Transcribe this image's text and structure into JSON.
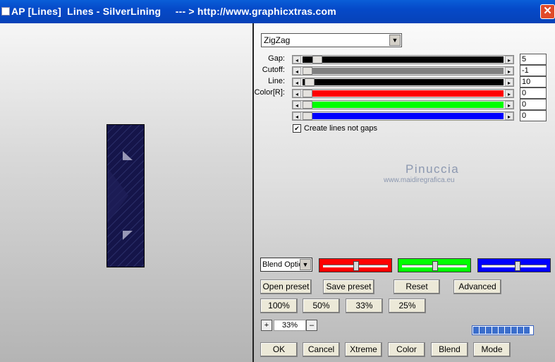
{
  "window": {
    "title": "AP [Lines]  Lines - SilverLining     --- > http://www.graphicxtras.com",
    "close_glyph": "✕"
  },
  "mode": {
    "value": "ZigZag",
    "arrow": "▼"
  },
  "sliders": [
    {
      "label": "Gap:",
      "value": "5",
      "fraction": 0.05,
      "color": "#000000"
    },
    {
      "label": "Cutoff:",
      "value": "-1",
      "fraction": 0.0,
      "color": "#808080"
    },
    {
      "label": "Line:",
      "value": "10",
      "fraction": 0.01,
      "color": "#000000"
    },
    {
      "label": "Color[R]:",
      "value": "0",
      "fraction": 0.0,
      "color": "#ff0000"
    },
    {
      "label": "",
      "value": "0",
      "fraction": 0.0,
      "color": "#00ff00"
    },
    {
      "label": "",
      "value": "0",
      "fraction": 0.0,
      "color": "#0000ff"
    }
  ],
  "checkbox": {
    "label": "Create lines not gaps",
    "checked": true,
    "mark": "✔"
  },
  "watermark": {
    "name": "Pinuccia",
    "url": "www.maidiregrafica.eu"
  },
  "blend": {
    "value": "Blend Options",
    "arrow": "▼"
  },
  "color_boxes": [
    {
      "color": "#ff0000",
      "level": 0.5
    },
    {
      "color": "#00ff00",
      "level": 0.5
    },
    {
      "color": "#0000ff",
      "level": 0.55
    }
  ],
  "preset_buttons": [
    "Open preset",
    "Save preset",
    "Reset",
    "Advanced"
  ],
  "zoom_buttons": [
    "100%",
    "50%",
    "33%",
    "25%"
  ],
  "zoom": {
    "plus": "+",
    "value": "33%",
    "minus": "–"
  },
  "bottom_buttons": [
    "OK",
    "Cancel",
    "Xtreme",
    "Color",
    "Blend",
    "Mode"
  ],
  "progress_segments": 9
}
